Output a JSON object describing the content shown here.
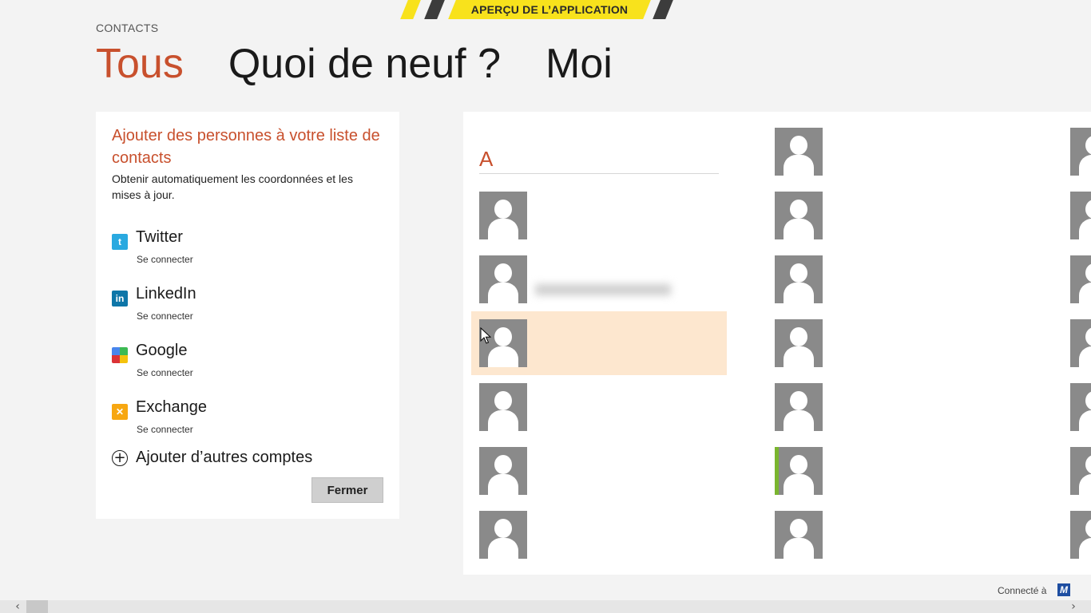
{
  "banner": {
    "label": "APERÇU DE L’APPLICATION"
  },
  "app": {
    "title": "CONTACTS"
  },
  "pivots": [
    {
      "label": "Tous",
      "active": true
    },
    {
      "label": "Quoi de neuf ?"
    },
    {
      "label": "Moi"
    }
  ],
  "add_panel": {
    "title": "Ajouter des personnes à votre liste de contacts",
    "subtitle": "Obtenir automatiquement les coordonnées et les mises à jour.",
    "accounts": [
      {
        "name": "Twitter",
        "action": "Se connecter",
        "icon": "twitter-icon"
      },
      {
        "name": "LinkedIn",
        "action": "Se connecter",
        "icon": "linkedin-icon"
      },
      {
        "name": "Google",
        "action": "Se connecter",
        "icon": "google-icon"
      },
      {
        "name": "Exchange",
        "action": "Se connecter",
        "icon": "exchange-icon"
      }
    ],
    "add_more": "Ajouter d’autres comptes",
    "close_label": "Fermer"
  },
  "contacts": {
    "group_letter": "A",
    "column1": [
      "",
      "",
      "",
      "",
      "",
      ""
    ],
    "column2": [
      "",
      "",
      "",
      "",
      "",
      "",
      ""
    ]
  },
  "footer": {
    "connected_label": "Connecté à"
  },
  "colors": {
    "accent": "#c8502d",
    "banner": "#f8e21c",
    "hover": "#fde7cf",
    "presence": "#7ab52e"
  }
}
